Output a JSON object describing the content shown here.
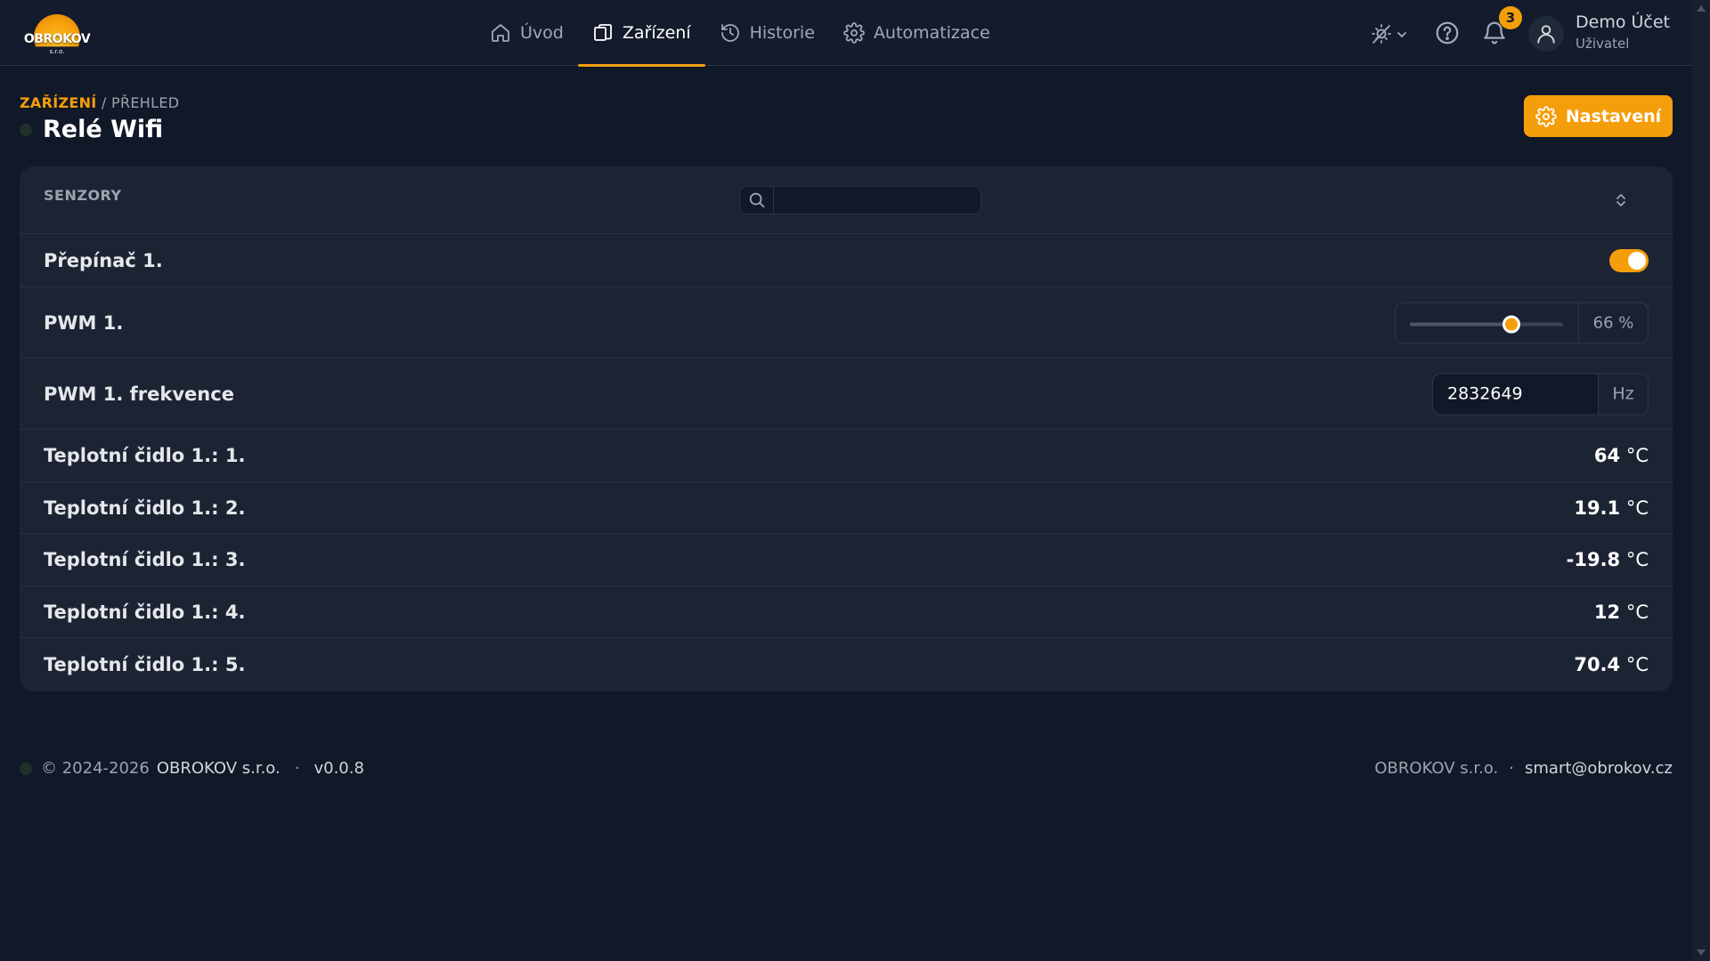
{
  "logo": {
    "name": "OBROKOV",
    "sub": "s.r.o."
  },
  "nav": {
    "items": [
      {
        "label": "Úvod",
        "icon": "home-icon"
      },
      {
        "label": "Zařízení",
        "icon": "devices-icon",
        "active": true
      },
      {
        "label": "Historie",
        "icon": "history-icon"
      },
      {
        "label": "Automatizace",
        "icon": "gear-icon"
      }
    ]
  },
  "header": {
    "notifications_count": "3",
    "user_name": "Demo Účet",
    "user_role": "Uživatel"
  },
  "breadcrumb": {
    "link": "ZAŘÍZENÍ",
    "separator": " / ",
    "current": "PŘEHLED"
  },
  "page": {
    "title": "Relé Wifi",
    "settings_label": "Nastavení"
  },
  "card": {
    "title": "SENZORY",
    "search_value": "",
    "rows": {
      "switch": {
        "label": "Přepínač 1.",
        "on": true
      },
      "pwm": {
        "label": "PWM 1.",
        "value": 66,
        "unit": "66 %"
      },
      "freq": {
        "label": "PWM 1. frekvence",
        "value": "2832649",
        "unit": "Hz"
      },
      "temps": [
        {
          "label": "Teplotní čidlo 1.: 1.",
          "value": "64",
          "unit": " °C"
        },
        {
          "label": "Teplotní čidlo 1.: 2.",
          "value": "19.1",
          "unit": " °C"
        },
        {
          "label": "Teplotní čidlo 1.: 3.",
          "value": "-19.8",
          "unit": " °C"
        },
        {
          "label": "Teplotní čidlo 1.: 4.",
          "value": "12",
          "unit": " °C"
        },
        {
          "label": "Teplotní čidlo 1.: 5.",
          "value": "70.4",
          "unit": " °C"
        }
      ]
    }
  },
  "footer": {
    "copyright": "© 2024-2026",
    "company": "OBROKOV s.r.o.",
    "bullet": "·",
    "version": "v0.0.8",
    "right_company": "OBROKOV s.r.o.",
    "right_bullet": "·",
    "email": "smart@obrokov.cz"
  },
  "colors": {
    "accent": "#f59e0b",
    "background": "#111827",
    "card": "#1c2434"
  }
}
